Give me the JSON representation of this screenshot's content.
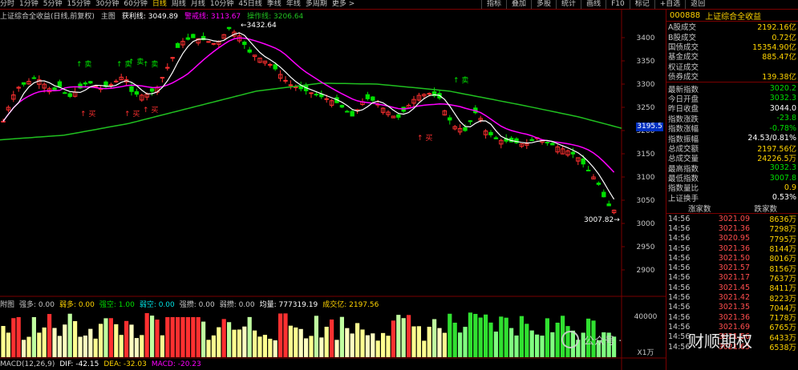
{
  "toolbar": {
    "periods": [
      "分时",
      "1分钟",
      "5分钟",
      "15分钟",
      "30分钟",
      "60分钟",
      "日线",
      "周线",
      "月线",
      "10分钟",
      "45日线",
      "季线",
      "年线",
      "多周期",
      "更多 >"
    ],
    "active_period": "日线",
    "tools": [
      "指标",
      "叠加",
      "多股",
      "统计",
      "画线",
      "F10",
      "标记",
      "+自选",
      "返回"
    ]
  },
  "main_legend": {
    "title": "上证综合全收益(日线,前复权)",
    "main": "主图",
    "ma1_label": "获利线: 3049.89",
    "ma2_label": "警戒线: 3113.67",
    "ma3_label": "操作线: 3206.64"
  },
  "price_axis": {
    "ticks": [
      3400,
      3350,
      3300,
      3250,
      3200,
      3150,
      3100,
      3050,
      3000,
      2950,
      2900
    ],
    "current_price": "3195.5"
  },
  "annotations": {
    "high_label": "3432.64",
    "low_label": "3007.82"
  },
  "buy_sell_labels": [
    "卖",
    "卖",
    "卖",
    "卖",
    "买",
    "买",
    "买",
    "卖",
    "买"
  ],
  "vol_legend": {
    "title": "附图",
    "items": [
      "强多: 0.00",
      "弱多: 0.00",
      "强空: 1.00",
      "弱空: 0.00",
      "强攒: 0.00",
      "弱攒: 0.00",
      "均量: 777319.19",
      "成交亿: 2197.56"
    ]
  },
  "vol_axis": {
    "tick": "40000"
  },
  "macd_legend": {
    "name": "MACD(12,26,9)",
    "dif": "DIF: -42.15",
    "dea": "DEA: -32.03",
    "macd": "MACD: -20.23"
  },
  "vol_unit": "X1万",
  "panel": {
    "code": "000888",
    "name": "上证综合全收益",
    "stats1": [
      {
        "k": "A股成交",
        "v": "2192.16亿",
        "c": "#ffd400"
      },
      {
        "k": "B股成交",
        "v": "0.72亿",
        "c": "#ffd400"
      },
      {
        "k": "国债成交",
        "v": "15354.90亿",
        "c": "#ffd400"
      },
      {
        "k": "基金成交",
        "v": "885.47亿",
        "c": "#ffd400"
      },
      {
        "k": "权证成交",
        "v": "",
        "c": "#ffd400"
      },
      {
        "k": "债券成交",
        "v": "139.38亿",
        "c": "#ffd400"
      }
    ],
    "stats2": [
      {
        "k": "最新指数",
        "v": "3020.2",
        "c": "#00e000"
      },
      {
        "k": "今日开盘",
        "v": "3032.3",
        "c": "#00e000"
      },
      {
        "k": "昨日收盘",
        "v": "3044.0",
        "c": "#ffffff"
      },
      {
        "k": "指数涨跌",
        "v": "-23.8",
        "c": "#00e000"
      },
      {
        "k": "指数涨幅",
        "v": "-0.78%",
        "c": "#00e000"
      },
      {
        "k": "指数振幅",
        "v": "24.53/0.81%",
        "c": "#ffffff"
      },
      {
        "k": "总成交额",
        "v": "2197.56亿",
        "c": "#ffd400"
      },
      {
        "k": "总成交量",
        "v": "24226.5万",
        "c": "#ffd400"
      },
      {
        "k": "最高指数",
        "v": "3032.3",
        "c": "#00e000"
      },
      {
        "k": "最低指数",
        "v": "3007.8",
        "c": "#00e000"
      },
      {
        "k": "指数量比",
        "v": "0.9",
        "c": "#ffd400"
      },
      {
        "k": "上证换手",
        "v": "0.53%",
        "c": "#ffffff"
      }
    ],
    "up_down": {
      "up": "涨家数",
      "down": "跌家数"
    },
    "ticks": [
      {
        "t": "14:56",
        "p": "3021.09",
        "q": "8636万"
      },
      {
        "t": "14:56",
        "p": "3021.36",
        "q": "7298万"
      },
      {
        "t": "14:56",
        "p": "3020.95",
        "q": "7795万"
      },
      {
        "t": "14:56",
        "p": "3021.36",
        "q": "8144万"
      },
      {
        "t": "14:56",
        "p": "3021.50",
        "q": "8016万"
      },
      {
        "t": "14:56",
        "p": "3021.57",
        "q": "8156万"
      },
      {
        "t": "14:56",
        "p": "3021.17",
        "q": "7637万"
      },
      {
        "t": "14:56",
        "p": "3021.45",
        "q": "8411万"
      },
      {
        "t": "14:56",
        "p": "3021.42",
        "q": "8223万"
      },
      {
        "t": "14:56",
        "p": "3021.35",
        "q": "7044万"
      },
      {
        "t": "14:56",
        "p": "3021.36",
        "q": "7178万"
      },
      {
        "t": "14:56",
        "p": "3021.69",
        "q": "6765万"
      },
      {
        "t": "14:56",
        "p": "3021.56",
        "q": "6433万"
      },
      {
        "t": "14:56",
        "p": "3021.65",
        "q": "6538万"
      }
    ]
  },
  "watermark": {
    "left": "公众号 ·",
    "right": "财顺期权"
  },
  "colors": {
    "up": "#ff3030",
    "down": "#00e000",
    "ma_white": "#ffffff",
    "ma_magenta": "#ff00ff",
    "ma_green": "#20c020",
    "bg": "#000000",
    "grid": "#5a0000"
  }
}
